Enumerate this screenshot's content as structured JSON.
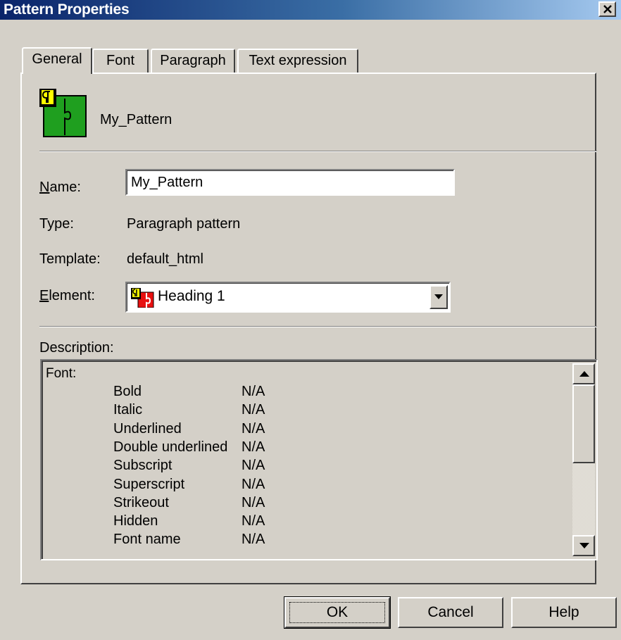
{
  "window": {
    "title": "Pattern Properties",
    "close_glyph": "×"
  },
  "tabs": [
    {
      "label": "General",
      "active": true
    },
    {
      "label": "Font",
      "active": false
    },
    {
      "label": "Paragraph",
      "active": false
    },
    {
      "label": "Text expression",
      "active": false
    }
  ],
  "header": {
    "icon": "paragraph-pattern-icon",
    "pattern_name": "My_Pattern"
  },
  "form": {
    "name_label_mnemonic": "N",
    "name_label_rest": "ame:",
    "name_value": "My_Pattern",
    "type_label": "Type:",
    "type_value": "Paragraph pattern",
    "template_label": "Template:",
    "template_value": "default_html",
    "element_label_mnemonic": "E",
    "element_label_rest": "lement:",
    "element_value": "Heading 1",
    "element_icon": "heading-element-icon"
  },
  "description": {
    "label": "Description:",
    "section": "Font:",
    "properties": [
      {
        "name": "Bold",
        "value": "N/A"
      },
      {
        "name": "Italic",
        "value": "N/A"
      },
      {
        "name": "Underlined",
        "value": "N/A"
      },
      {
        "name": "Double underlined",
        "value": "N/A"
      },
      {
        "name": "Subscript",
        "value": "N/A"
      },
      {
        "name": "Superscript",
        "value": "N/A"
      },
      {
        "name": "Strikeout",
        "value": "N/A"
      },
      {
        "name": "Hidden",
        "value": "N/A"
      },
      {
        "name": "Font name",
        "value": "N/A"
      }
    ]
  },
  "buttons": {
    "ok": "OK",
    "cancel": "Cancel",
    "help": "Help"
  },
  "colors": {
    "title_gradient_start": "#0a246a",
    "title_gradient_end": "#a6caf0",
    "dialog_face": "#d4d0c8",
    "icon_green": "#1f9f1f",
    "icon_red": "#e81010",
    "icon_yellow": "#ffff00"
  }
}
